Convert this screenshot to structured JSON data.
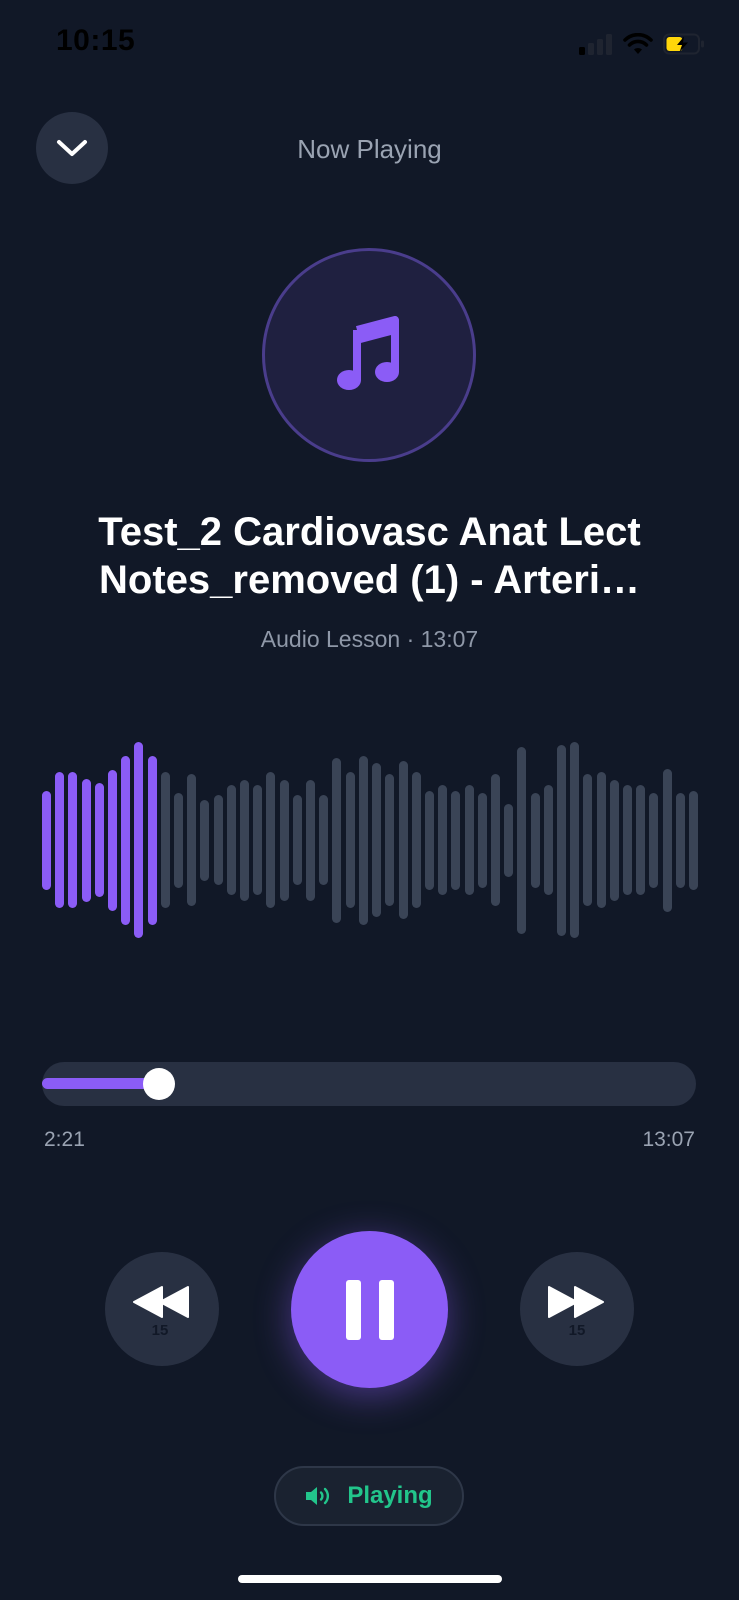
{
  "status_bar": {
    "time": "10:15"
  },
  "header": {
    "title": "Now Playing"
  },
  "track": {
    "title": "Test_2 Cardiovasc Anat Lect Notes_removed (1) - Arteri…",
    "meta": "Audio Lesson · 13:07"
  },
  "progress": {
    "elapsed": "2:21",
    "total": "13:07",
    "fraction": 0.179
  },
  "controls": {
    "skip_back_label": "15",
    "skip_forward_label": "15"
  },
  "status_pill": {
    "label": "Playing"
  },
  "waveform": {
    "played_count": 9,
    "levels": [
      0.45,
      0.62,
      0.62,
      0.56,
      0.52,
      0.64,
      0.77,
      0.89,
      0.77,
      0.62,
      0.43,
      0.6,
      0.37,
      0.41,
      0.5,
      0.55,
      0.5,
      0.62,
      0.55,
      0.41,
      0.55,
      0.41,
      0.75,
      0.62,
      0.77,
      0.7,
      0.6,
      0.72,
      0.62,
      0.45,
      0.5,
      0.45,
      0.5,
      0.43,
      0.6,
      0.33,
      0.85,
      0.43,
      0.5,
      0.87,
      0.89,
      0.6,
      0.62,
      0.55,
      0.5,
      0.5,
      0.43,
      0.65,
      0.43,
      0.45
    ],
    "played_color": "#8b5cf6",
    "unplayed_color": "#3a4456"
  },
  "colors": {
    "background": "#111827",
    "accent": "#8b5cf6",
    "playing_green": "#22c58b",
    "battery_yellow": "#ffd60a"
  },
  "icons": {
    "collapse": "chevron-down-icon",
    "artwork": "music-note-icon",
    "skip_back": "rewind-icon",
    "skip_forward": "fast-forward-icon",
    "play_pause": "pause-icon",
    "speaker": "speaker-icon"
  }
}
